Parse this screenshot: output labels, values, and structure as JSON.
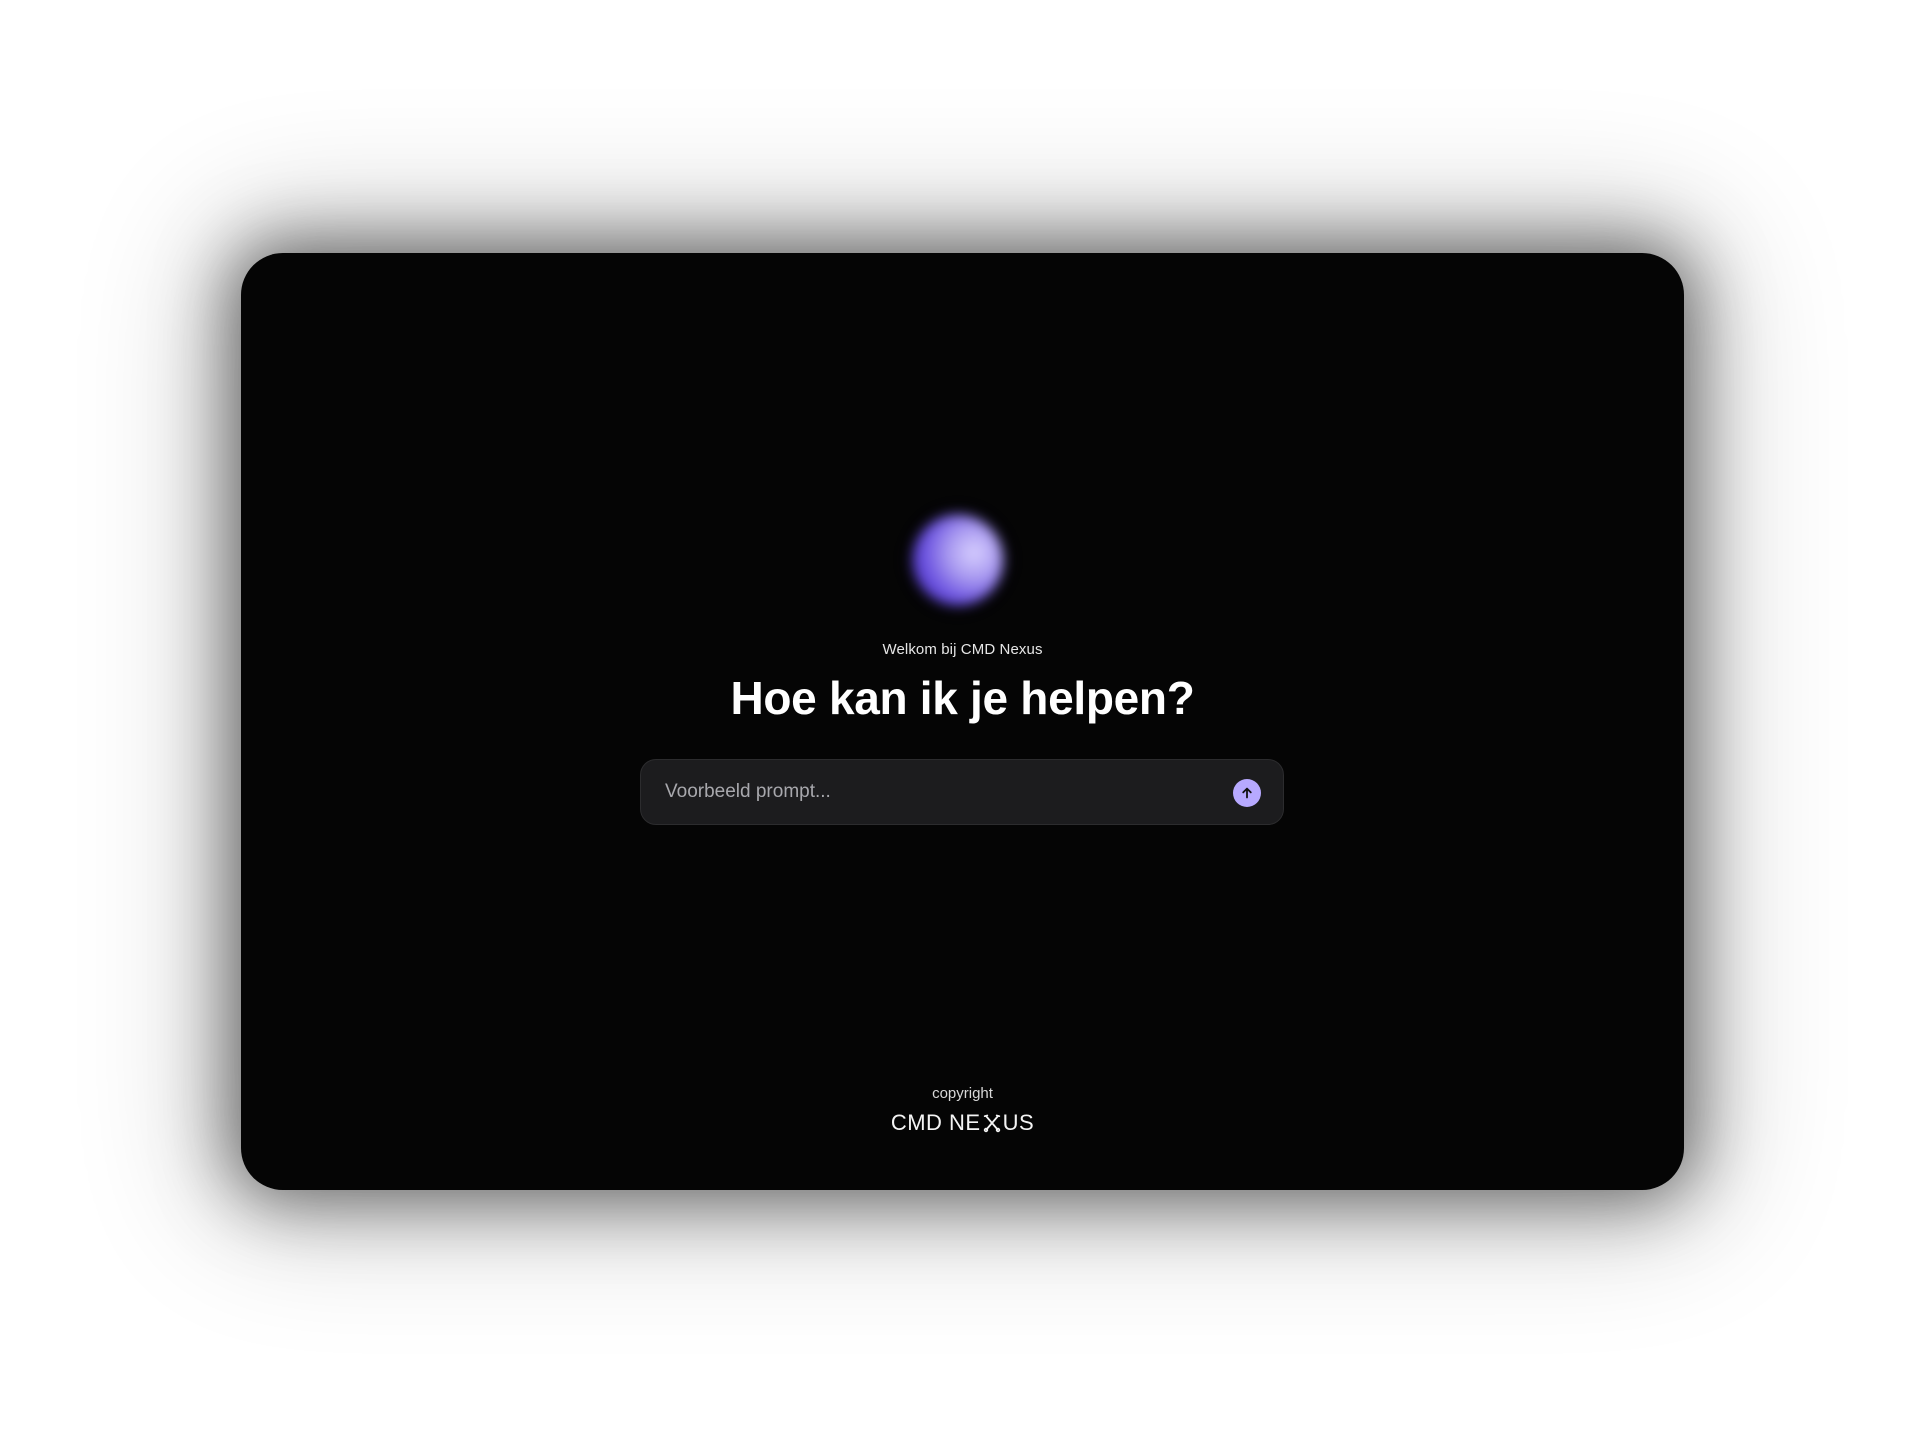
{
  "welcome": {
    "subtitle": "Welkom bij CMD Nexus",
    "headline": "Hoe kan ik je helpen?"
  },
  "prompt": {
    "value": "",
    "placeholder": "Voorbeeld prompt...",
    "send_icon": "arrow-up-icon"
  },
  "footer": {
    "copyright": "copyright",
    "logo_text_before": "CMD NE",
    "logo_x_icon": "crossed-tools-icon",
    "logo_text_after": "US"
  },
  "colors": {
    "window_background": "#050505",
    "prompt_background": "#1c1c1e",
    "accent": "#b7a9ff",
    "orb": "#6b52e0"
  }
}
